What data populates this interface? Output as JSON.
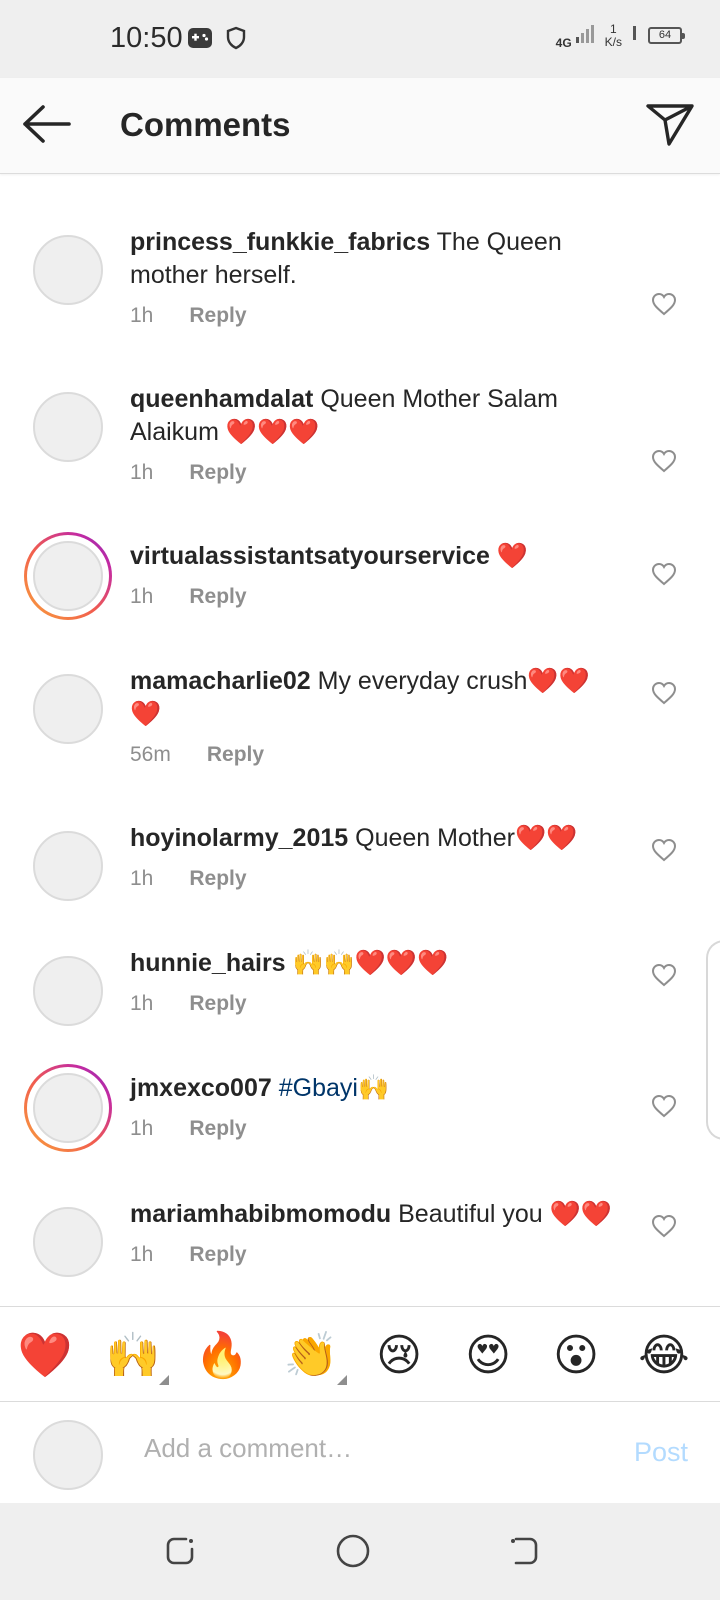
{
  "status_bar": {
    "time": "10:50",
    "network": "4G",
    "speed_value": "1",
    "speed_unit": "K/s",
    "battery": "64"
  },
  "header": {
    "title": "Comments"
  },
  "comments": [
    {
      "username": "princess_funkkie_fabrics",
      "text": "The Queen mother herself.",
      "time": "1h",
      "reply": "Reply",
      "story": false
    },
    {
      "username": "queenhamdalat",
      "text": "Queen Mother Salam Alaikum ❤️❤️❤️",
      "time": "1h",
      "reply": "Reply",
      "story": false
    },
    {
      "username": "virtualassistantsatyourservice",
      "text": "❤️",
      "time": "1h",
      "reply": "Reply",
      "story": true
    },
    {
      "username": "mamacharlie02",
      "text": "My everyday crush❤️❤️❤️",
      "time": "56m",
      "reply": "Reply",
      "story": false
    },
    {
      "username": "hoyinolarmy_2015",
      "text": "Queen Mother❤️❤️",
      "time": "1h",
      "reply": "Reply",
      "story": false
    },
    {
      "username": "hunnie_hairs",
      "text": "🙌🙌❤️❤️❤️",
      "time": "1h",
      "reply": "Reply",
      "story": false
    },
    {
      "username": "jmxexco007",
      "hashtag": "#Gbayi",
      "text": "🙌",
      "time": "1h",
      "reply": "Reply",
      "story": true
    },
    {
      "username": "mariamhabibmomodu",
      "text": "Beautiful you ❤️❤️",
      "time": "1h",
      "reply": "Reply",
      "story": false
    }
  ],
  "emoji_bar": [
    "❤️",
    "🙌",
    "🔥",
    "👏",
    "😢",
    "😍",
    "😮",
    "😂"
  ],
  "compose": {
    "placeholder": "Add a comment…",
    "post_label": "Post"
  },
  "icons": {
    "back": "arrow-left-icon",
    "send": "paper-plane-icon",
    "like": "heart-outline-icon"
  },
  "colors": {
    "link": "#003569",
    "post_disabled": "#b3dbff",
    "meta": "#8e8e8e"
  }
}
